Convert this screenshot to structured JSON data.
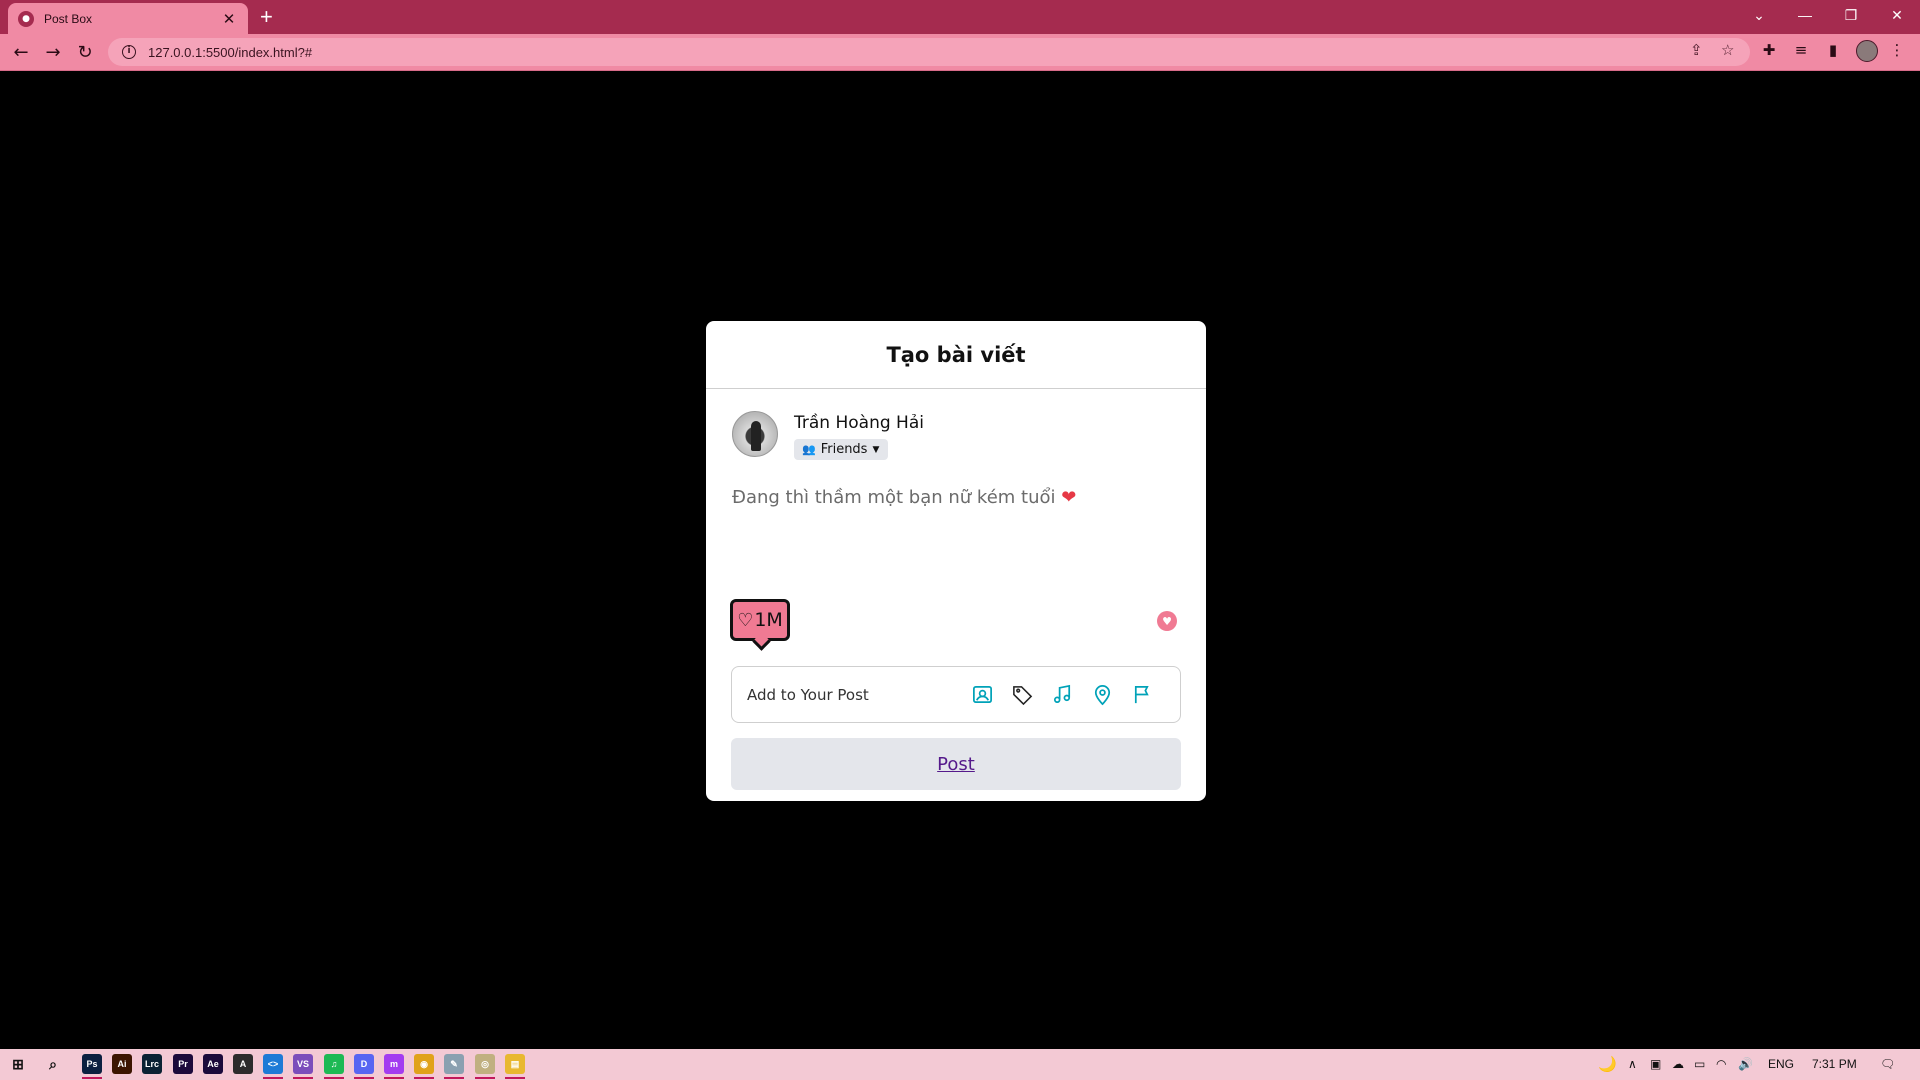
{
  "browser": {
    "tab_title": "Post Box",
    "tab_close": "✕",
    "new_tab": "+",
    "url": "127.0.0.1:5500/index.html?#",
    "colors": {
      "tabbar": "#a52b4f",
      "toolbar": "#f08aa4"
    }
  },
  "post": {
    "title": "Tạo bài viết",
    "author_name": "Trần Hoàng Hải",
    "audience": "Friends",
    "content": "Đang thì thầm một bạn nữ kém tuổi",
    "content_emoji": "❤",
    "badge_count": "1M",
    "add_label": "Add to Your Post",
    "add_icons": [
      "photo-icon",
      "tag-icon",
      "music-icon",
      "location-icon",
      "flag-icon"
    ],
    "post_button": "Post",
    "accent_color": "#00a2b8"
  },
  "taskbar": {
    "apps": [
      {
        "name": "photoshop",
        "label": "Ps",
        "color": "#0b2040"
      },
      {
        "name": "illustrator",
        "label": "Ai",
        "color": "#3b1500"
      },
      {
        "name": "lightroom-classic",
        "label": "Lrc",
        "color": "#0a2233"
      },
      {
        "name": "premiere",
        "label": "Pr",
        "color": "#1c0a3b"
      },
      {
        "name": "after-effects",
        "label": "Ae",
        "color": "#1a0a3b"
      },
      {
        "name": "app-a",
        "label": "A",
        "color": "#2c2c2c"
      },
      {
        "name": "vscode",
        "label": "<>",
        "color": "#1e7ad6"
      },
      {
        "name": "visual-studio",
        "label": "VS",
        "color": "#7b4dbb"
      },
      {
        "name": "spotify",
        "label": "♫",
        "color": "#1db954"
      },
      {
        "name": "discord",
        "label": "D",
        "color": "#5865f2"
      },
      {
        "name": "messenger",
        "label": "m",
        "color": "#a33cf0"
      },
      {
        "name": "chrome",
        "label": "◉",
        "color": "#e0a21a"
      },
      {
        "name": "app-draw",
        "label": "✎",
        "color": "#8aa0b0"
      },
      {
        "name": "app-globe",
        "label": "◎",
        "color": "#c0b080"
      },
      {
        "name": "file-explorer",
        "label": "▤",
        "color": "#e8b830"
      }
    ],
    "language": "ENG",
    "time": "7:31 PM"
  }
}
